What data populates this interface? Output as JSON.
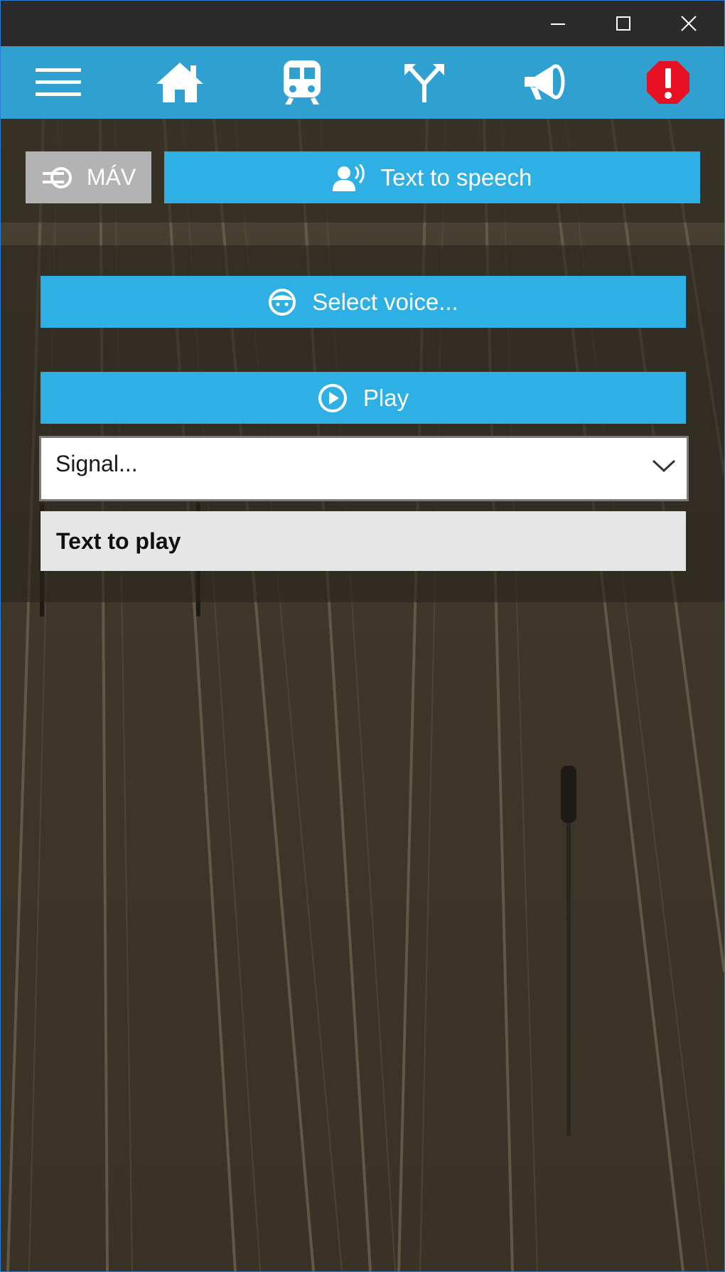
{
  "window": {
    "controls": {
      "minimize": "minimize-icon",
      "maximize": "maximize-icon",
      "close": "close-icon"
    }
  },
  "nav": {
    "items": [
      {
        "name": "menu",
        "icon": "hamburger-menu-icon"
      },
      {
        "name": "home",
        "icon": "home-icon"
      },
      {
        "name": "train",
        "icon": "train-icon"
      },
      {
        "name": "junction",
        "icon": "track-switch-icon"
      },
      {
        "name": "announce",
        "icon": "megaphone-icon"
      },
      {
        "name": "alert",
        "icon": "alert-icon"
      }
    ],
    "alert_color": "#e81123"
  },
  "top": {
    "mav_label": "MÁV",
    "tts_label": "Text to speech"
  },
  "content": {
    "select_voice_label": "Select voice...",
    "play_label": "Play",
    "signal_value": "Signal...",
    "text_placeholder": "Text to play"
  },
  "colors": {
    "nav_bg": "#2fa0cf",
    "accent": "#2fb0e4",
    "mav_bg": "#b3b3b3"
  }
}
